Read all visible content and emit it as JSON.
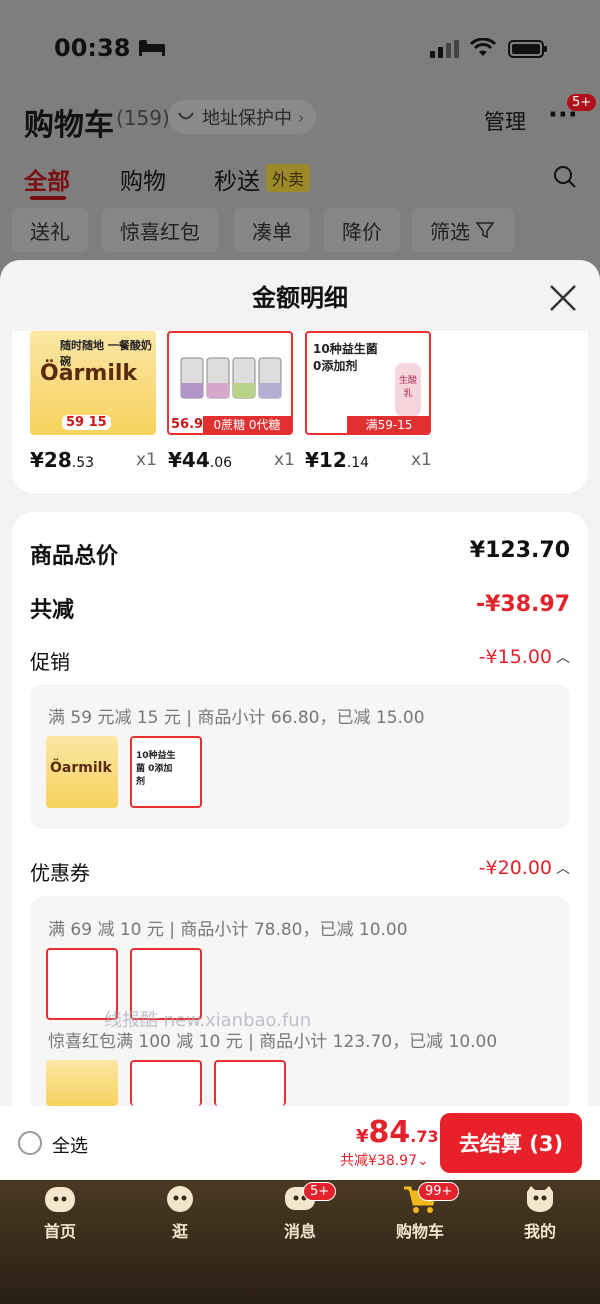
{
  "status": {
    "time": "00:38"
  },
  "header": {
    "title": "购物车",
    "count": "(159)",
    "address": "地址保护中",
    "manage": "管理",
    "more_badge": "5+"
  },
  "tabs": [
    {
      "label": "全部"
    },
    {
      "label": "购物"
    },
    {
      "label": "秒送"
    }
  ],
  "tab_tag": "外卖",
  "chips": [
    "送礼",
    "惊喜红包",
    "凑单",
    "降价",
    "筛选"
  ],
  "sheet": {
    "title": "金额明细",
    "products": [
      {
        "price_int": "¥28",
        "price_dec": ".53",
        "qty": "x1",
        "img_text": "随时随地 一餐酸奶碗",
        "brand": "Öarmilk",
        "tag": "59 15"
      },
      {
        "price_int": "¥44",
        "price_dec": ".06",
        "qty": "x1",
        "img_text": "0蔗糖 0代糖",
        "brand": "",
        "tag": "56.9"
      },
      {
        "price_int": "¥12",
        "price_dec": ".14",
        "qty": "x1",
        "img_text": "10种益生菌 0添加剂",
        "brand": "生酸乳",
        "tag": "满59-15"
      }
    ],
    "goods_total_label": "商品总价",
    "goods_total": "¥123.70",
    "discount_label": "共减",
    "discount_total": "-¥38.97",
    "promo_label": "促销",
    "promo_amount": "-¥15.00",
    "promo_rule": "满 59 元减 15 元 | 商品小计 66.80，已减 15.00",
    "coupon_label": "优惠券",
    "coupon_amount": "-¥20.00",
    "coupon_rule_1": "满 69 减 10 元 | 商品小计 78.80，已减 10.00",
    "coupon_rule_2": "惊喜红包满 100 减 10 元 | 商品小计 123.70，已减 10.00",
    "watermark": "线报酷 new.xianbao.fun"
  },
  "bottom": {
    "select_all": "全选",
    "currency": "¥",
    "total_int": "84",
    "total_dec": ".73",
    "saved": "共减¥38.97",
    "checkout": "去结算 (3)"
  },
  "tabbar": [
    {
      "label": "首页",
      "badge": ""
    },
    {
      "label": "逛",
      "badge": ""
    },
    {
      "label": "消息",
      "badge": "5+"
    },
    {
      "label": "购物车",
      "badge": "99+"
    },
    {
      "label": "我的",
      "badge": ""
    }
  ],
  "colors": {
    "accent_red": "#e4222b",
    "tab_active": "#7a0e12",
    "checkout_bg": "#e8202a",
    "tabbar_bg": "#3a2c1c"
  }
}
